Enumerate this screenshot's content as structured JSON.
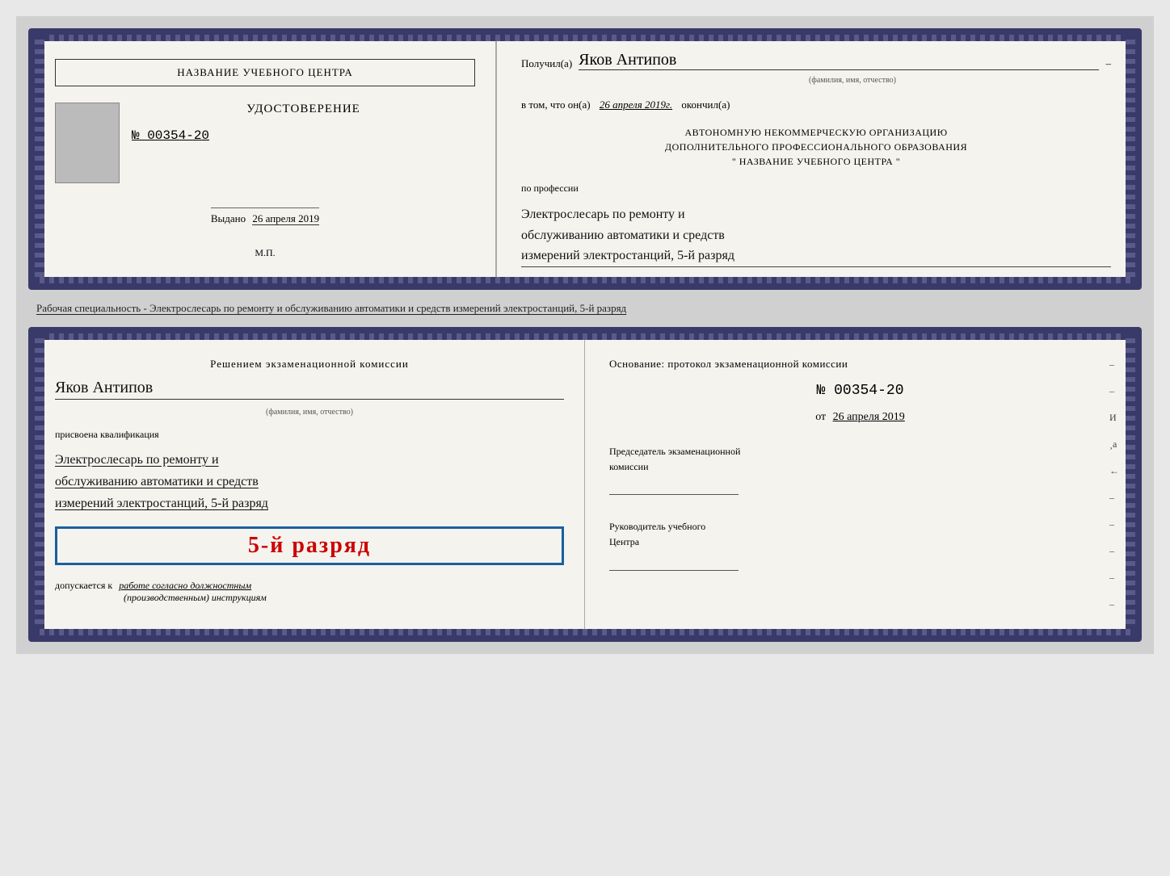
{
  "topDoc": {
    "left": {
      "orgNameLabel": "НАЗВАНИЕ УЧЕБНОГО ЦЕНТРА",
      "certTitle": "УДОСТОВЕРЕНИЕ",
      "certNumber": "№ 00354-20",
      "issuedLabel": "Выдано",
      "issuedDate": "26 апреля 2019",
      "stampLabel": "М.П."
    },
    "right": {
      "receivedPrefix": "Получил(а)",
      "recipientName": "Яков Антипов",
      "fioSubtitle": "(фамилия, имя, отчество)",
      "datePrefix": "в том, что он(а)",
      "date": "26 апреля 2019г.",
      "dateFinished": "окончил(а)",
      "orgLine1": "АВТОНОМНУЮ НЕКОММЕРЧЕСКУЮ ОРГАНИЗАЦИЮ",
      "orgLine2": "ДОПОЛНИТЕЛЬНОГО ПРОФЕССИОНАЛЬНОГО ОБРАЗОВАНИЯ",
      "orgLine3": "\"  НАЗВАНИЕ УЧЕБНОГО ЦЕНТРА  \"",
      "professionLabel": "по профессии",
      "professionLine1": "Электрослесарь по ремонту и",
      "professionLine2": "обслуживанию автоматики и средств",
      "professionLine3": "измерений электростанций, 5-й разряд"
    }
  },
  "middleText": "Рабочая специальность - Электрослесарь по ремонту и обслуживанию автоматики и средств измерений электростанций, 5-й разряд",
  "bottomDoc": {
    "left": {
      "decisionTitle": "Решением экзаменационной комиссии",
      "fioName": "Яков Антипов",
      "fioSubtitle": "(фамилия, имя, отчество)",
      "assignedLabel": "присвоена квалификация",
      "qualLine1": "Электрослесарь по ремонту и",
      "qualLine2": "обслуживанию автоматики и средств",
      "qualLine3": "измерений электростанций, 5-й разряд",
      "razryadText": "5-й разряд",
      "dopuskPrefix": "допускается к",
      "dopuskHandwritten": "работе согласно должностным",
      "dopuskLine2": "(производственным) инструкциям"
    },
    "right": {
      "osnovLabel": "Основание: протокол экзаменационной комиссии",
      "protocolPrefix": "№",
      "protocolNumber": "00354-20",
      "datePrefix": "от",
      "date": "26 апреля 2019",
      "chairmanTitle": "Председатель экзаменационной",
      "chairmanTitle2": "комиссии",
      "headTitle": "Руководитель учебного",
      "headTitle2": "Центра"
    }
  }
}
